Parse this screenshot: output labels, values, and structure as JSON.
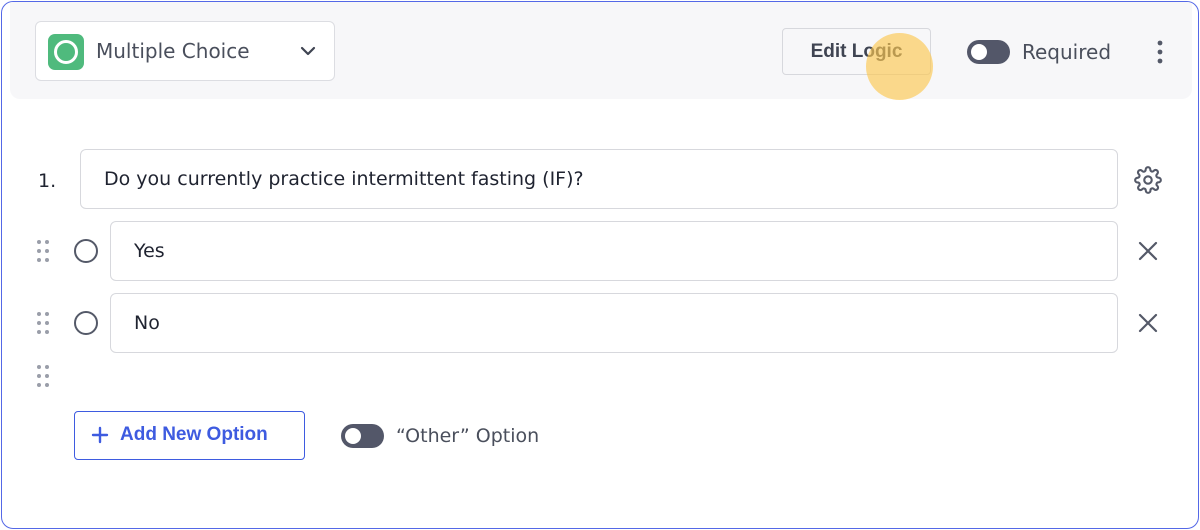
{
  "header": {
    "question_type": {
      "label": "Multiple Choice",
      "icon": "radio-circle-icon",
      "icon_color": "#4fba7d"
    },
    "edit_logic_label": "Edit Logic",
    "required": {
      "label": "Required",
      "enabled": false
    }
  },
  "question": {
    "number": "1.",
    "text": "Do you currently practice intermittent fasting (IF)?"
  },
  "options": [
    {
      "label": "Yes"
    },
    {
      "label": "No"
    }
  ],
  "footer": {
    "add_option_label": "Add New Option",
    "other_option": {
      "label": "“Other” Option",
      "enabled": false
    }
  },
  "colors": {
    "accent": "#3e5be0",
    "card_border": "#5468e7",
    "toggle_off": "#535769",
    "cursor_highlight": "#fcc850"
  }
}
